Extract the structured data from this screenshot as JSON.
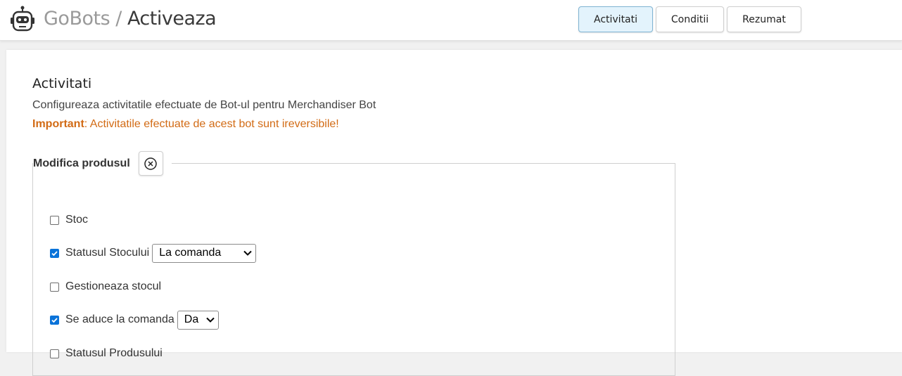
{
  "header": {
    "app_name": "GoBots",
    "separator": "/",
    "page_name": "Activeaza",
    "logo_icon": "robot-icon",
    "steps": [
      {
        "label": "Activitati",
        "active": true
      },
      {
        "label": "Conditii",
        "active": false
      },
      {
        "label": "Rezumat",
        "active": false
      }
    ]
  },
  "section": {
    "title": "Activitati",
    "description": "Configureaza activitatile efectuate de Bot-ul pentru Merchandiser Bot",
    "warning_label": "Important",
    "warning_text": ": Activitatile efectuate de acest bot sunt ireversibile!"
  },
  "group": {
    "title": "Modifica produsul",
    "remove_icon": "circle-x-icon",
    "options": [
      {
        "label": "Stoc",
        "checked": false
      },
      {
        "label": "Statusul Stocului",
        "checked": true,
        "select_value": "La comanda"
      },
      {
        "label": "Gestioneaza stocul",
        "checked": false
      },
      {
        "label": "Se aduce la comanda",
        "checked": true,
        "select_value": "Da"
      },
      {
        "label": "Statusul Produsului",
        "checked": false
      }
    ]
  },
  "colors": {
    "accent": "#0a73d9",
    "warning": "#d26b15",
    "active_step_bg": "#e3f3fc"
  }
}
